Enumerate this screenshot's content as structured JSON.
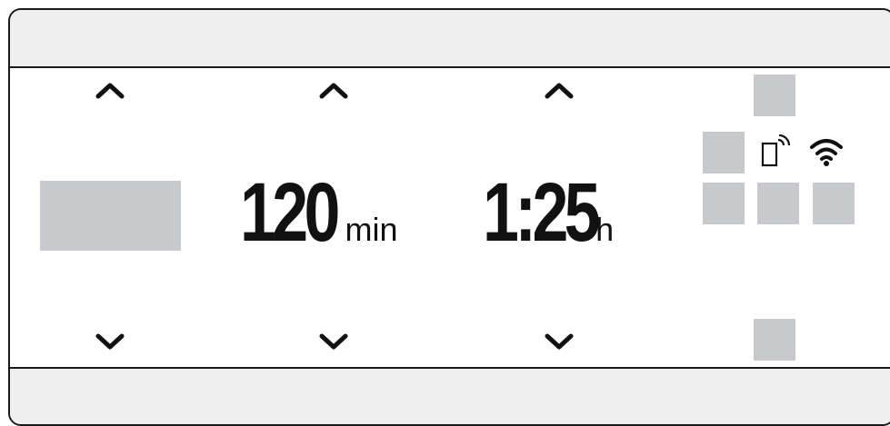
{
  "display": {
    "duration": {
      "value": "120",
      "unit": "min"
    },
    "clock": {
      "value": "1:25",
      "unit": "h"
    }
  },
  "icons": {
    "remote": "phone-remote-icon",
    "wifi": "wifi-icon",
    "up": "chevron-up-icon",
    "down": "chevron-down-icon"
  },
  "colors": {
    "block": "#c8c9cc",
    "bar": "#efefef",
    "ink": "#111111"
  }
}
